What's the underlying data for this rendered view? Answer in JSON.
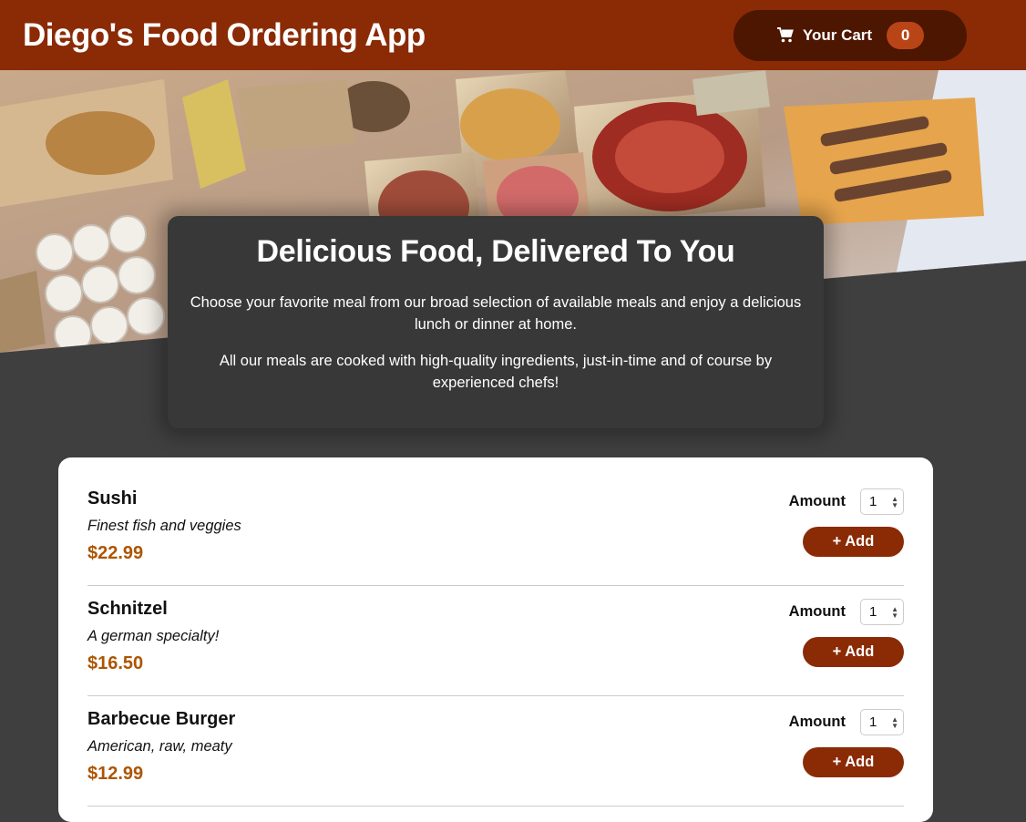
{
  "header": {
    "title": "Diego's Food Ordering App",
    "cart": {
      "label": "Your Cart",
      "count": "0",
      "icon": "cart-icon"
    }
  },
  "colors": {
    "header_bg": "#8a2b06",
    "cart_button_bg": "#4d1601",
    "badge_bg": "#b94517",
    "price": "#ad5502",
    "page_bg": "#3f3f3f"
  },
  "summary": {
    "heading": "Delicious Food, Delivered To You",
    "paragraph1": "Choose your favorite meal from our broad selection of available meals and enjoy a delicious lunch or dinner at home.",
    "paragraph2": "All our meals are cooked with high-quality ingredients, just-in-time and of course by experienced chefs!"
  },
  "meals": [
    {
      "name": "Sushi",
      "description": "Finest fish and veggies",
      "price": "$22.99",
      "amount_label": "Amount",
      "amount": "1",
      "add_label": "+ Add"
    },
    {
      "name": "Schnitzel",
      "description": "A german specialty!",
      "price": "$16.50",
      "amount_label": "Amount",
      "amount": "1",
      "add_label": "+ Add"
    },
    {
      "name": "Barbecue Burger",
      "description": "American, raw, meaty",
      "price": "$12.99",
      "amount_label": "Amount",
      "amount": "1",
      "add_label": "+ Add"
    }
  ]
}
